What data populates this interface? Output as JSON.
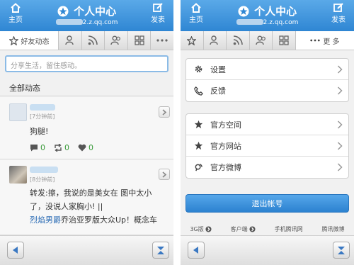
{
  "header": {
    "home_label": "主页",
    "title": "个人中心",
    "subdomain_suffix": "2.z.qq.com",
    "post_label": "发表"
  },
  "left": {
    "tabs": [
      {
        "label": "好友动态"
      }
    ],
    "composer_placeholder": "分享生活，留住感动。",
    "feed_title": "全部动态",
    "posts": [
      {
        "time": "[7分钟前]",
        "text": "狗腿!",
        "comments": "0",
        "reposts": "0",
        "likes": "0"
      },
      {
        "time": "[8分钟前]",
        "text": "转发:擦，我说的是美女在 图中太小了，没说人家胸小! ||",
        "link": "烈焰男爵",
        "text2": "乔治亚罗版大众Up！概念车"
      }
    ]
  },
  "right": {
    "more_label": "更 多",
    "group1": [
      {
        "label": "设置",
        "icon": "gear-icon"
      },
      {
        "label": "反馈",
        "icon": "phone-icon"
      }
    ],
    "group2": [
      {
        "label": "官方空间",
        "icon": "star-icon"
      },
      {
        "label": "官方网站",
        "icon": "star-icon"
      },
      {
        "label": "官方微博",
        "icon": "weibo-icon"
      }
    ],
    "logout_label": "退出帐号",
    "footer": [
      {
        "label": "3G版"
      },
      {
        "label": "客户端"
      },
      {
        "label": "手机腾讯网"
      },
      {
        "label": "腾讯微博"
      }
    ]
  },
  "colors": {
    "accent": "#2f86d3",
    "link": "#2b6cb5",
    "stat": "#3a9b3a"
  }
}
